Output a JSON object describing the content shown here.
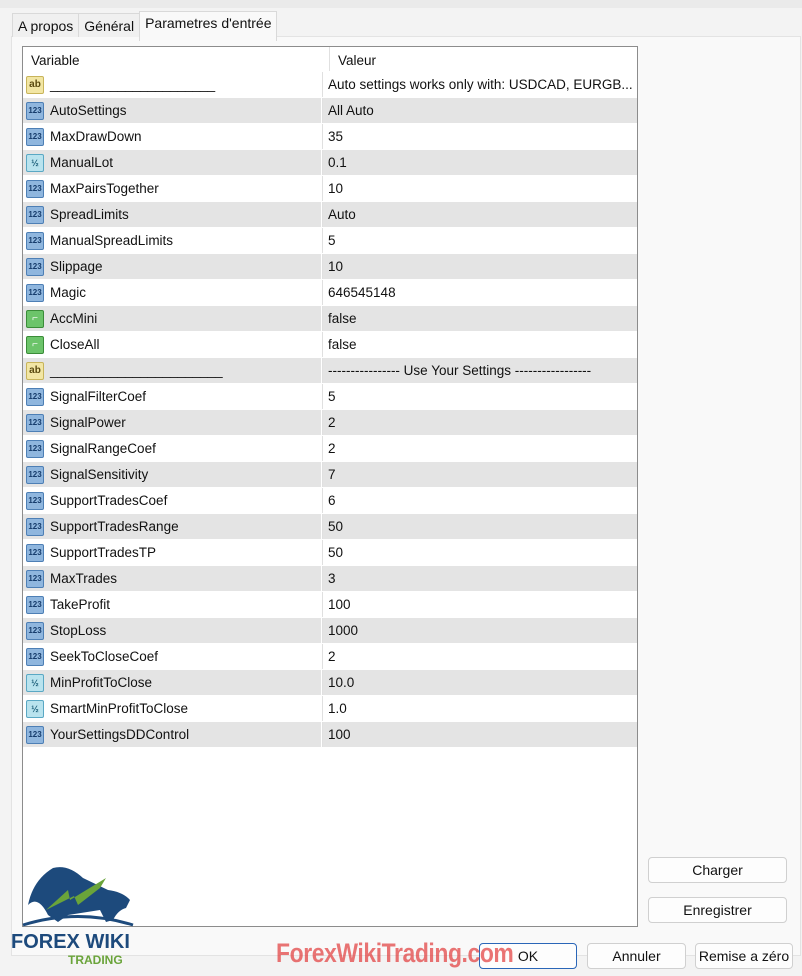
{
  "tabs": [
    "A propos",
    "Général",
    "Parametres d'entrée"
  ],
  "table": {
    "col_variable": "Variable",
    "col_value": "Valeur",
    "rows": [
      {
        "type": "ab",
        "icon": "string-icon",
        "label": "ab",
        "name": "______________________",
        "value": "Auto settings works only with: USDCAD, EURGB..."
      },
      {
        "type": "num",
        "icon": "integer-icon",
        "label": "123",
        "name": "AutoSettings",
        "value": "All Auto"
      },
      {
        "type": "num",
        "icon": "integer-icon",
        "label": "123",
        "name": "MaxDrawDown",
        "value": "35"
      },
      {
        "type": "frac",
        "icon": "double-icon",
        "label": "½",
        "name": "ManualLot",
        "value": "0.1"
      },
      {
        "type": "num",
        "icon": "integer-icon",
        "label": "123",
        "name": "MaxPairsTogether",
        "value": "10"
      },
      {
        "type": "num",
        "icon": "integer-icon",
        "label": "123",
        "name": "SpreadLimits",
        "value": "Auto"
      },
      {
        "type": "num",
        "icon": "integer-icon",
        "label": "123",
        "name": "ManualSpreadLimits",
        "value": "5"
      },
      {
        "type": "num",
        "icon": "integer-icon",
        "label": "123",
        "name": "Slippage",
        "value": "10"
      },
      {
        "type": "num",
        "icon": "integer-icon",
        "label": "123",
        "name": "Magic",
        "value": "646545148"
      },
      {
        "type": "bool",
        "icon": "boolean-icon",
        "label": "⌐",
        "name": "AccMini",
        "value": "false"
      },
      {
        "type": "bool",
        "icon": "boolean-icon",
        "label": "⌐",
        "name": "CloseAll",
        "value": "false"
      },
      {
        "type": "ab",
        "icon": "string-icon",
        "label": "ab",
        "name": "_______________________",
        "value": "----------------  Use Your Settings -----------------"
      },
      {
        "type": "num",
        "icon": "integer-icon",
        "label": "123",
        "name": "SignalFilterCoef",
        "value": "5"
      },
      {
        "type": "num",
        "icon": "integer-icon",
        "label": "123",
        "name": "SignalPower",
        "value": "2"
      },
      {
        "type": "num",
        "icon": "integer-icon",
        "label": "123",
        "name": "SignalRangeCoef",
        "value": "2"
      },
      {
        "type": "num",
        "icon": "integer-icon",
        "label": "123",
        "name": "SignalSensitivity",
        "value": "7"
      },
      {
        "type": "num",
        "icon": "integer-icon",
        "label": "123",
        "name": "SupportTradesCoef",
        "value": "6"
      },
      {
        "type": "num",
        "icon": "integer-icon",
        "label": "123",
        "name": "SupportTradesRange",
        "value": "50"
      },
      {
        "type": "num",
        "icon": "integer-icon",
        "label": "123",
        "name": "SupportTradesTP",
        "value": "50"
      },
      {
        "type": "num",
        "icon": "integer-icon",
        "label": "123",
        "name": "MaxTrades",
        "value": "3"
      },
      {
        "type": "num",
        "icon": "integer-icon",
        "label": "123",
        "name": "TakeProfit",
        "value": "100"
      },
      {
        "type": "num",
        "icon": "integer-icon",
        "label": "123",
        "name": "StopLoss",
        "value": "1000"
      },
      {
        "type": "num",
        "icon": "integer-icon",
        "label": "123",
        "name": "SeekToCloseCoef",
        "value": "2"
      },
      {
        "type": "frac",
        "icon": "double-icon",
        "label": "½",
        "name": "MinProfitToClose",
        "value": "10.0"
      },
      {
        "type": "frac",
        "icon": "double-icon",
        "label": "½",
        "name": "SmartMinProfitToClose",
        "value": "1.0"
      },
      {
        "type": "num",
        "icon": "integer-icon",
        "label": "123",
        "name": "YourSettingsDDControl",
        "value": "100"
      }
    ]
  },
  "buttons": {
    "load": "Charger",
    "save": "Enregistrer",
    "ok": "OK",
    "cancel": "Annuler",
    "reset": "Remise a zéro"
  },
  "watermark": "ForexWikiTrading.com",
  "logo": {
    "line1": "FOREX WIKI",
    "line2": "TRADING"
  }
}
